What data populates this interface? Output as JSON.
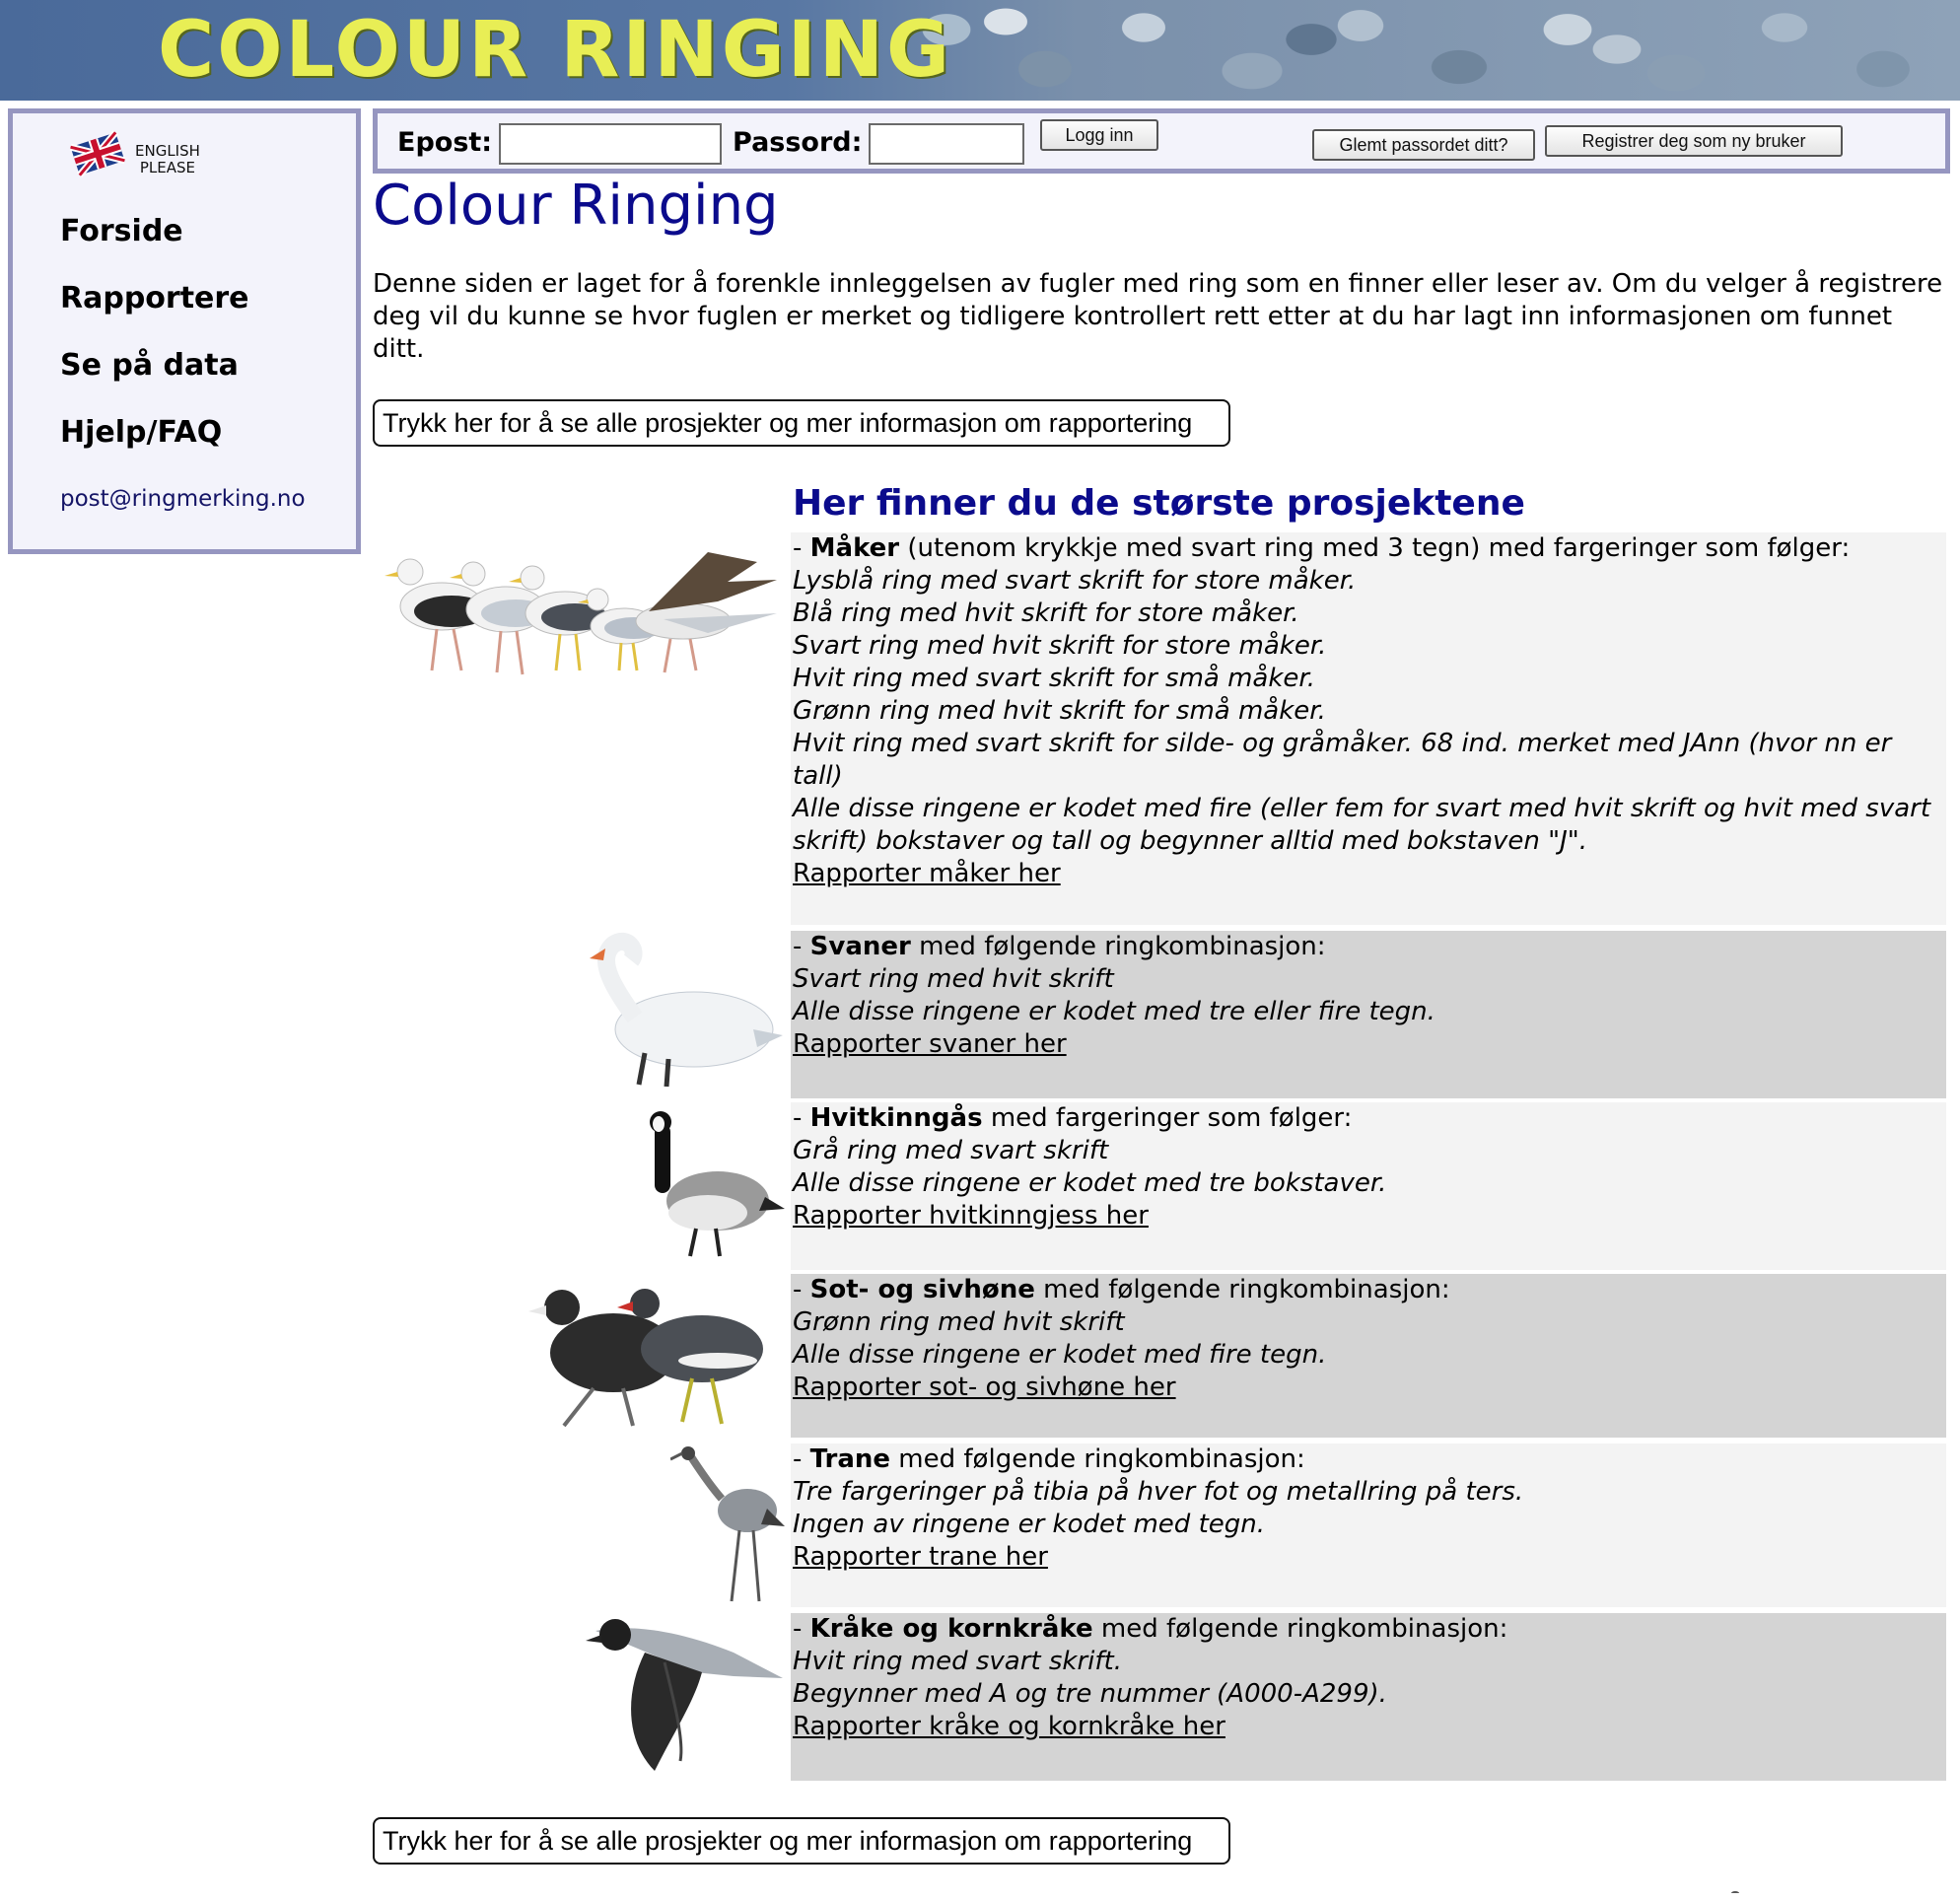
{
  "banner": {
    "title": "COLOUR RINGING"
  },
  "sidebar": {
    "english_line1": "ENGLISH",
    "english_line2": "PLEASE",
    "nav": [
      {
        "label": "Forside"
      },
      {
        "label": "Rapportere"
      },
      {
        "label": "Se på data"
      },
      {
        "label": "Hjelp/FAQ"
      }
    ],
    "email": "post@ringmerking.no"
  },
  "login": {
    "email_label": "Epost:",
    "password_label": "Passord:",
    "email_value": "",
    "password_value": "",
    "login_button": "Logg inn",
    "forgot_button": "Glemt passordet ditt?",
    "register_button": "Registrer deg som ny bruker"
  },
  "main": {
    "title": "Colour Ringing",
    "intro": "Denne siden er laget for å forenkle innleggelsen av fugler med ring som en finner eller leser av. Om du velger å registrere deg vil du kunne se hvor fuglen er merket og tidligere kontrollert rett etter at du har lagt inn informasjonen om funnet ditt.",
    "projects_button": "Trykk her for å se alle prosjekter og mer informasjon om rapportering",
    "section_title": "Her finner du de største prosjektene"
  },
  "projects": [
    {
      "name": "Måker",
      "desc": " (utenom krykkje med svart ring med 3 tegn) med fargeringer som følger:",
      "lines": [
        "Lysblå ring med svart skrift for store måker.",
        "Blå ring med hvit skrift for store måker.",
        "Svart ring med hvit skrift for store måker.",
        "Hvit ring med svart skrift for små måker.",
        "Grønn ring med hvit skrift for små måker.",
        "Hvit ring med svart skrift for silde- og gråmåker. 68 ind. merket med JAnn (hvor nn er tall)",
        "Alle disse ringene er kodet med fire (eller fem for svart med hvit skrift og hvit med svart skrift) bokstaver og tall og begynner alltid med bokstaven \"J\"."
      ],
      "link": "Rapporter måker her"
    },
    {
      "name": "Svaner",
      "desc": " med følgende ringkombinasjon:",
      "lines": [
        "Svart ring med hvit skrift",
        "Alle disse ringene er kodet med tre eller fire tegn."
      ],
      "link": "Rapporter svaner her"
    },
    {
      "name": "Hvitkinngås",
      "desc": " med fargeringer som følger:",
      "lines": [
        "Grå ring med svart skrift",
        "Alle disse ringene er kodet med tre bokstaver."
      ],
      "link": "Rapporter hvitkinngjess her"
    },
    {
      "name": "Sot- og sivhøne",
      "desc": " med følgende ringkombinasjon:",
      "lines": [
        "Grønn ring med hvit skrift",
        "Alle disse ringene er kodet med fire tegn."
      ],
      "link": "Rapporter sot- og sivhøne her"
    },
    {
      "name": "Trane",
      "desc": " med følgende ringkombinasjon:",
      "lines": [
        "Tre fargeringer på tibia på hver fot og metallring på ters.",
        "Ingen av ringene er kodet med tegn."
      ],
      "link": "Rapporter trane her"
    },
    {
      "name": "Kråke og kornkråke",
      "desc": " med følgende ringkombinasjon:",
      "lines": [
        "Hvit ring med svart skrift.",
        "Begynner med A og tre nummer (A000-A299)."
      ],
      "link": "Rapporter kråke og kornkråke her"
    }
  ],
  "dash": "- "
}
